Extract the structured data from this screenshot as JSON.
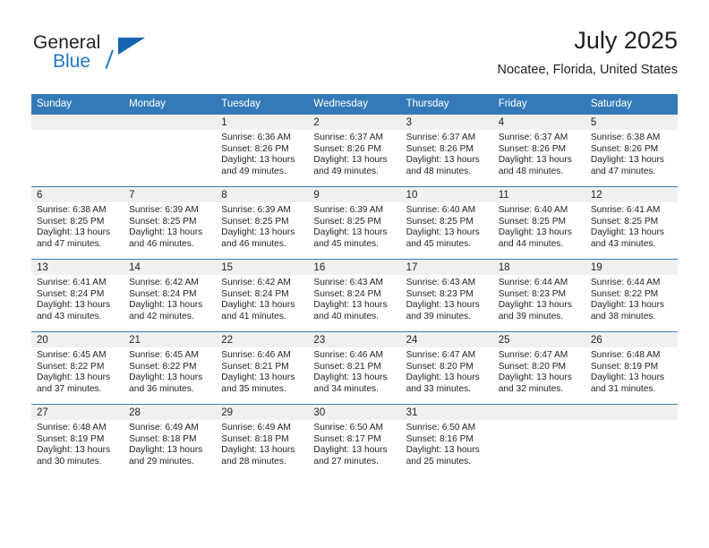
{
  "brand": {
    "name_top": "General",
    "name_bottom": "Blue",
    "triangle_color": "#1566ad",
    "blue_color": "#1f78c1"
  },
  "header": {
    "title": "July 2025",
    "subtitle": "Nocatee, Florida, United States"
  },
  "theme": {
    "header_row_bg": "#357ab8",
    "header_row_text": "#ffffff",
    "date_strip_bg": "#f0f0f0",
    "row_separator": "#3a7cb8",
    "cell_bg": "#ffffff",
    "text": "#231f20"
  },
  "weekday_headers": [
    "Sunday",
    "Monday",
    "Tuesday",
    "Wednesday",
    "Thursday",
    "Friday",
    "Saturday"
  ],
  "labels": {
    "sunrise_prefix": "Sunrise:",
    "sunset_prefix": "Sunset:",
    "daylight_prefix": "Daylight:"
  },
  "weeks": [
    [
      {
        "day": "",
        "sunrise": "",
        "sunset": "",
        "daylight": "",
        "empty": true
      },
      {
        "day": "",
        "sunrise": "",
        "sunset": "",
        "daylight": "",
        "empty": true
      },
      {
        "day": "1",
        "sunrise": "Sunrise: 6:36 AM",
        "sunset": "Sunset: 8:26 PM",
        "daylight": "Daylight: 13 hours and 49 minutes."
      },
      {
        "day": "2",
        "sunrise": "Sunrise: 6:37 AM",
        "sunset": "Sunset: 8:26 PM",
        "daylight": "Daylight: 13 hours and 49 minutes."
      },
      {
        "day": "3",
        "sunrise": "Sunrise: 6:37 AM",
        "sunset": "Sunset: 8:26 PM",
        "daylight": "Daylight: 13 hours and 48 minutes."
      },
      {
        "day": "4",
        "sunrise": "Sunrise: 6:37 AM",
        "sunset": "Sunset: 8:26 PM",
        "daylight": "Daylight: 13 hours and 48 minutes."
      },
      {
        "day": "5",
        "sunrise": "Sunrise: 6:38 AM",
        "sunset": "Sunset: 8:26 PM",
        "daylight": "Daylight: 13 hours and 47 minutes."
      }
    ],
    [
      {
        "day": "6",
        "sunrise": "Sunrise: 6:38 AM",
        "sunset": "Sunset: 8:25 PM",
        "daylight": "Daylight: 13 hours and 47 minutes."
      },
      {
        "day": "7",
        "sunrise": "Sunrise: 6:39 AM",
        "sunset": "Sunset: 8:25 PM",
        "daylight": "Daylight: 13 hours and 46 minutes."
      },
      {
        "day": "8",
        "sunrise": "Sunrise: 6:39 AM",
        "sunset": "Sunset: 8:25 PM",
        "daylight": "Daylight: 13 hours and 46 minutes."
      },
      {
        "day": "9",
        "sunrise": "Sunrise: 6:39 AM",
        "sunset": "Sunset: 8:25 PM",
        "daylight": "Daylight: 13 hours and 45 minutes."
      },
      {
        "day": "10",
        "sunrise": "Sunrise: 6:40 AM",
        "sunset": "Sunset: 8:25 PM",
        "daylight": "Daylight: 13 hours and 45 minutes."
      },
      {
        "day": "11",
        "sunrise": "Sunrise: 6:40 AM",
        "sunset": "Sunset: 8:25 PM",
        "daylight": "Daylight: 13 hours and 44 minutes."
      },
      {
        "day": "12",
        "sunrise": "Sunrise: 6:41 AM",
        "sunset": "Sunset: 8:25 PM",
        "daylight": "Daylight: 13 hours and 43 minutes."
      }
    ],
    [
      {
        "day": "13",
        "sunrise": "Sunrise: 6:41 AM",
        "sunset": "Sunset: 8:24 PM",
        "daylight": "Daylight: 13 hours and 43 minutes."
      },
      {
        "day": "14",
        "sunrise": "Sunrise: 6:42 AM",
        "sunset": "Sunset: 8:24 PM",
        "daylight": "Daylight: 13 hours and 42 minutes."
      },
      {
        "day": "15",
        "sunrise": "Sunrise: 6:42 AM",
        "sunset": "Sunset: 8:24 PM",
        "daylight": "Daylight: 13 hours and 41 minutes."
      },
      {
        "day": "16",
        "sunrise": "Sunrise: 6:43 AM",
        "sunset": "Sunset: 8:24 PM",
        "daylight": "Daylight: 13 hours and 40 minutes."
      },
      {
        "day": "17",
        "sunrise": "Sunrise: 6:43 AM",
        "sunset": "Sunset: 8:23 PM",
        "daylight": "Daylight: 13 hours and 39 minutes."
      },
      {
        "day": "18",
        "sunrise": "Sunrise: 6:44 AM",
        "sunset": "Sunset: 8:23 PM",
        "daylight": "Daylight: 13 hours and 39 minutes."
      },
      {
        "day": "19",
        "sunrise": "Sunrise: 6:44 AM",
        "sunset": "Sunset: 8:22 PM",
        "daylight": "Daylight: 13 hours and 38 minutes."
      }
    ],
    [
      {
        "day": "20",
        "sunrise": "Sunrise: 6:45 AM",
        "sunset": "Sunset: 8:22 PM",
        "daylight": "Daylight: 13 hours and 37 minutes."
      },
      {
        "day": "21",
        "sunrise": "Sunrise: 6:45 AM",
        "sunset": "Sunset: 8:22 PM",
        "daylight": "Daylight: 13 hours and 36 minutes."
      },
      {
        "day": "22",
        "sunrise": "Sunrise: 6:46 AM",
        "sunset": "Sunset: 8:21 PM",
        "daylight": "Daylight: 13 hours and 35 minutes."
      },
      {
        "day": "23",
        "sunrise": "Sunrise: 6:46 AM",
        "sunset": "Sunset: 8:21 PM",
        "daylight": "Daylight: 13 hours and 34 minutes."
      },
      {
        "day": "24",
        "sunrise": "Sunrise: 6:47 AM",
        "sunset": "Sunset: 8:20 PM",
        "daylight": "Daylight: 13 hours and 33 minutes."
      },
      {
        "day": "25",
        "sunrise": "Sunrise: 6:47 AM",
        "sunset": "Sunset: 8:20 PM",
        "daylight": "Daylight: 13 hours and 32 minutes."
      },
      {
        "day": "26",
        "sunrise": "Sunrise: 6:48 AM",
        "sunset": "Sunset: 8:19 PM",
        "daylight": "Daylight: 13 hours and 31 minutes."
      }
    ],
    [
      {
        "day": "27",
        "sunrise": "Sunrise: 6:48 AM",
        "sunset": "Sunset: 8:19 PM",
        "daylight": "Daylight: 13 hours and 30 minutes."
      },
      {
        "day": "28",
        "sunrise": "Sunrise: 6:49 AM",
        "sunset": "Sunset: 8:18 PM",
        "daylight": "Daylight: 13 hours and 29 minutes."
      },
      {
        "day": "29",
        "sunrise": "Sunrise: 6:49 AM",
        "sunset": "Sunset: 8:18 PM",
        "daylight": "Daylight: 13 hours and 28 minutes."
      },
      {
        "day": "30",
        "sunrise": "Sunrise: 6:50 AM",
        "sunset": "Sunset: 8:17 PM",
        "daylight": "Daylight: 13 hours and 27 minutes."
      },
      {
        "day": "31",
        "sunrise": "Sunrise: 6:50 AM",
        "sunset": "Sunset: 8:16 PM",
        "daylight": "Daylight: 13 hours and 25 minutes."
      },
      {
        "day": "",
        "sunrise": "",
        "sunset": "",
        "daylight": "",
        "empty": true
      },
      {
        "day": "",
        "sunrise": "",
        "sunset": "",
        "daylight": "",
        "empty": true
      }
    ]
  ]
}
